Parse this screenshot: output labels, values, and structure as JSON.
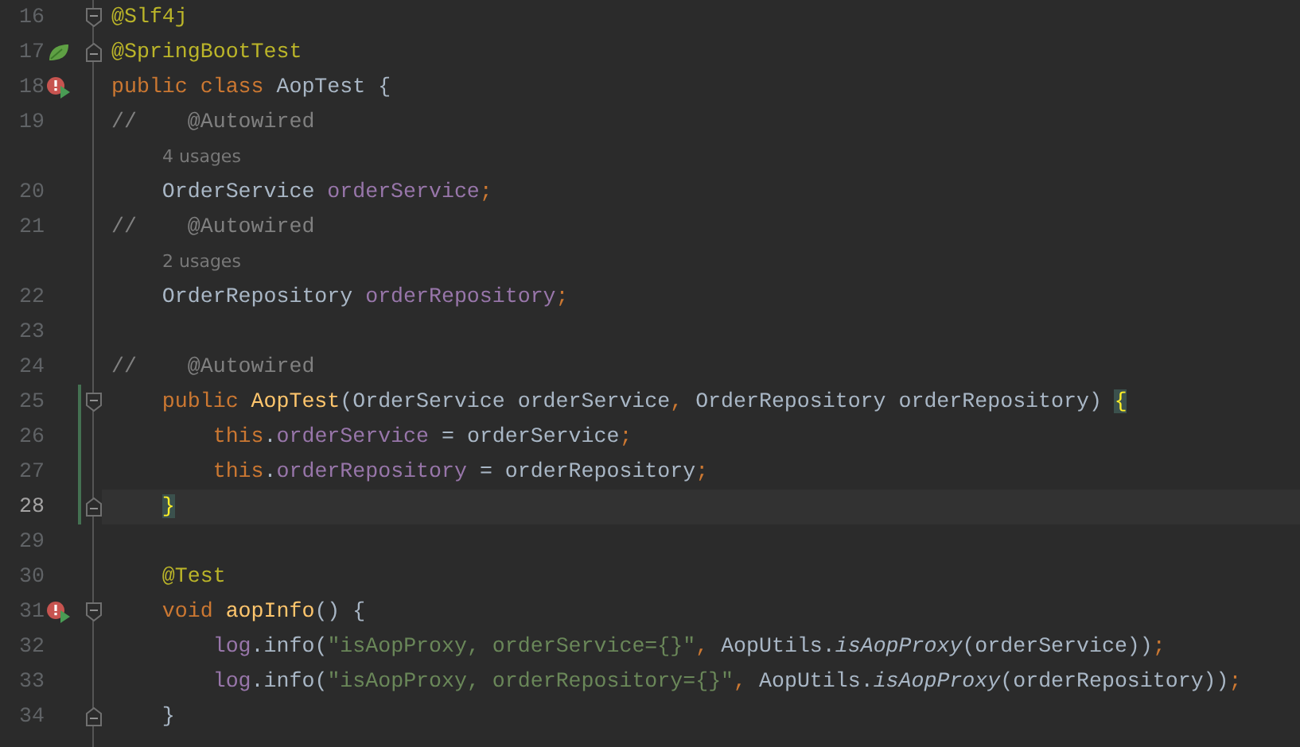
{
  "editor": {
    "rows": [
      {
        "kind": "code",
        "number": "16",
        "fold_marker": {
          "kind": "start"
        },
        "tokens": [
          {
            "text": "@Slf4j",
            "kind": "ann"
          }
        ]
      },
      {
        "kind": "code",
        "number": "17",
        "gutter_icon": {
          "kind": "spring"
        },
        "fold_marker": {
          "kind": "end"
        },
        "tokens": [
          {
            "text": "@SpringBootTest",
            "kind": "ann"
          }
        ]
      },
      {
        "kind": "code",
        "number": "18",
        "gutter_icon": {
          "kind": "run-failed"
        },
        "tokens": [
          {
            "text": "public class ",
            "kind": "kw"
          },
          {
            "text": "AopTest {",
            "kind": "txt"
          }
        ]
      },
      {
        "kind": "code",
        "number": "19",
        "tokens": [
          {
            "text": "//    @Autowired",
            "kind": "cmt"
          }
        ]
      },
      {
        "kind": "hint",
        "text": "4 usages"
      },
      {
        "kind": "code",
        "number": "20",
        "tokens": [
          {
            "text": "    OrderService ",
            "kind": "txt"
          },
          {
            "text": "orderService",
            "kind": "fld"
          },
          {
            "text": ";",
            "kind": "kw"
          }
        ]
      },
      {
        "kind": "code",
        "number": "21",
        "tokens": [
          {
            "text": "//    @Autowired",
            "kind": "cmt"
          }
        ]
      },
      {
        "kind": "hint",
        "text": "2 usages"
      },
      {
        "kind": "code",
        "number": "22",
        "tokens": [
          {
            "text": "    OrderRepository ",
            "kind": "txt"
          },
          {
            "text": "orderRepository",
            "kind": "fld"
          },
          {
            "text": ";",
            "kind": "kw"
          }
        ]
      },
      {
        "kind": "code",
        "number": "23"
      },
      {
        "kind": "code",
        "number": "24",
        "tokens": [
          {
            "text": "//    @Autowired",
            "kind": "cmt"
          }
        ]
      },
      {
        "kind": "code",
        "number": "25",
        "changed": true,
        "fold_marker": {
          "kind": "start"
        },
        "tokens": [
          {
            "text": "    public ",
            "kind": "kw"
          },
          {
            "text": "AopTest",
            "kind": "mdecl"
          },
          {
            "text": "(OrderService orderService",
            "kind": "txt"
          },
          {
            "text": ", ",
            "kind": "kw"
          },
          {
            "text": "OrderRepository orderRepository) ",
            "kind": "txt"
          },
          {
            "text": "{",
            "kind": "match"
          }
        ]
      },
      {
        "kind": "code",
        "number": "26",
        "changed": true,
        "tokens": [
          {
            "text": "        this",
            "kind": "kw"
          },
          {
            "text": ".",
            "kind": "txt"
          },
          {
            "text": "orderService",
            "kind": "fld"
          },
          {
            "text": " = orderService",
            "kind": "txt"
          },
          {
            "text": ";",
            "kind": "kw"
          }
        ]
      },
      {
        "kind": "code",
        "number": "27",
        "changed": true,
        "tokens": [
          {
            "text": "        this",
            "kind": "kw"
          },
          {
            "text": ".",
            "kind": "txt"
          },
          {
            "text": "orderRepository",
            "kind": "fld"
          },
          {
            "text": " = orderRepository",
            "kind": "txt"
          },
          {
            "text": ";",
            "kind": "kw"
          }
        ]
      },
      {
        "kind": "code",
        "number": "28",
        "changed": true,
        "current": true,
        "fold_marker": {
          "kind": "end"
        },
        "tokens": [
          {
            "text": "    }",
            "kind": "match"
          }
        ]
      },
      {
        "kind": "code",
        "number": "29"
      },
      {
        "kind": "code",
        "number": "30",
        "tokens": [
          {
            "text": "    @Test",
            "kind": "ann"
          }
        ]
      },
      {
        "kind": "code",
        "number": "31",
        "gutter_icon": {
          "kind": "run-failed"
        },
        "fold_marker": {
          "kind": "start"
        },
        "tokens": [
          {
            "text": "    void ",
            "kind": "kw"
          },
          {
            "text": "aopInfo",
            "kind": "mdecl"
          },
          {
            "text": "() {",
            "kind": "txt"
          }
        ]
      },
      {
        "kind": "code",
        "number": "32",
        "tokens": [
          {
            "text": "        log",
            "kind": "fld"
          },
          {
            "text": ".info(",
            "kind": "txt"
          },
          {
            "text": "\"isAopProxy, orderService={}\"",
            "kind": "str"
          },
          {
            "text": ", ",
            "kind": "kw"
          },
          {
            "text": "AopUtils.",
            "kind": "txt"
          },
          {
            "text": "isAopProxy",
            "kind": "stat"
          },
          {
            "text": "(orderService))",
            "kind": "txt"
          },
          {
            "text": ";",
            "kind": "kw"
          }
        ]
      },
      {
        "kind": "code",
        "number": "33",
        "tokens": [
          {
            "text": "        log",
            "kind": "fld"
          },
          {
            "text": ".info(",
            "kind": "txt"
          },
          {
            "text": "\"isAopProxy, orderRepository={}\"",
            "kind": "str"
          },
          {
            "text": ", ",
            "kind": "kw"
          },
          {
            "text": "AopUtils.",
            "kind": "txt"
          },
          {
            "text": "isAopProxy",
            "kind": "stat"
          },
          {
            "text": "(orderRepository))",
            "kind": "txt"
          },
          {
            "text": ";",
            "kind": "kw"
          }
        ]
      },
      {
        "kind": "code",
        "number": "34",
        "fold_marker": {
          "kind": "end"
        },
        "tokens": [
          {
            "text": "    }",
            "kind": "txt"
          }
        ]
      }
    ]
  }
}
